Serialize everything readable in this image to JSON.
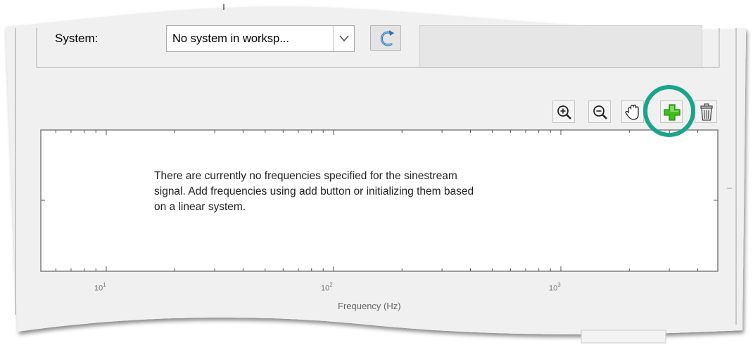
{
  "system": {
    "label": "System:",
    "value": "No system in worksp..."
  },
  "toolbar": {
    "buttons": [
      {
        "name": "zoom-in",
        "icon": "zoom-in-icon"
      },
      {
        "name": "zoom-out",
        "icon": "zoom-out-icon"
      },
      {
        "name": "pan",
        "icon": "hand-icon"
      },
      {
        "name": "add",
        "icon": "plus-icon",
        "highlighted": true
      },
      {
        "name": "delete",
        "icon": "trash-icon"
      }
    ]
  },
  "plot": {
    "message": [
      "There are currently no frequencies specified for the sinestream",
      "signal. Add frequencies using add button or initializing them based",
      "on a linear system."
    ],
    "x_ticks": [
      {
        "base": "10",
        "exp": "1"
      },
      {
        "base": "10",
        "exp": "2"
      },
      {
        "base": "10",
        "exp": "3"
      }
    ],
    "xlabel": "Frequency (Hz)",
    "x_scale": "log"
  },
  "colors": {
    "highlight_ring": "#1aa58a",
    "add_icon": "#3dbf1b",
    "panel_bg": "#f0f0f0"
  }
}
